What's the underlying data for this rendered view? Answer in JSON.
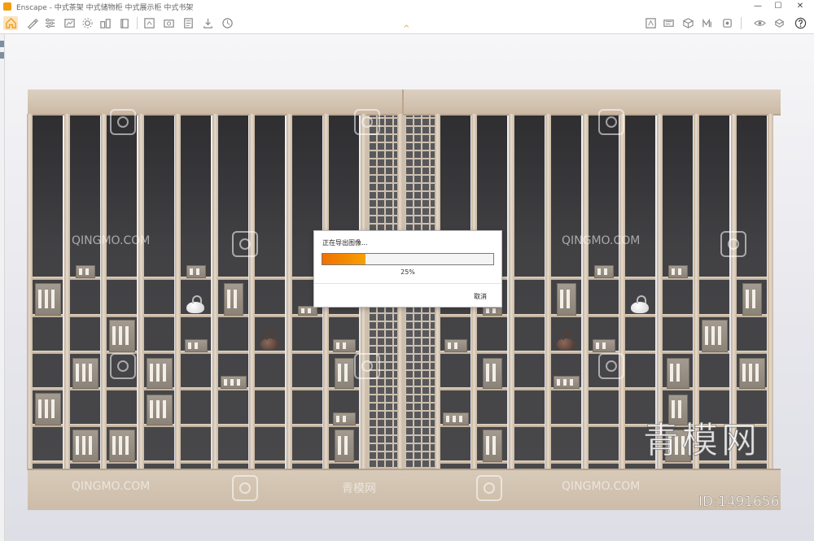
{
  "window": {
    "title": "Enscape - 中式茶架 中式储物柜 中式展示柜 中式书架",
    "minimize": "—",
    "maximize": "☐",
    "close": "✕"
  },
  "toolbar": {
    "icons_left": [
      "home-icon",
      "pen-icon",
      "sliders-icon",
      "drawing-icon",
      "settings-icon",
      "asset-library-icon",
      "book-icon",
      "upload-icon",
      "screenshot-icon",
      "batch-render-icon",
      "export-icon",
      "manage-icon"
    ],
    "icons_right": [
      "presentation-icon",
      "views-icon",
      "capture-icon",
      "visual-settings-icon",
      "material-icon",
      "info-icon",
      "vr-icon",
      "help-icon"
    ],
    "collapse_glyph": "^",
    "accent_color": "#f0a020"
  },
  "dialog": {
    "title": "正在导出图像...",
    "progress": 25,
    "progress_text": "25%",
    "cancel": "取消"
  },
  "watermarks": {
    "site": "QINGMO.COM",
    "site_cn": "青模网",
    "big": "青模网",
    "id": "ID:1491656"
  }
}
